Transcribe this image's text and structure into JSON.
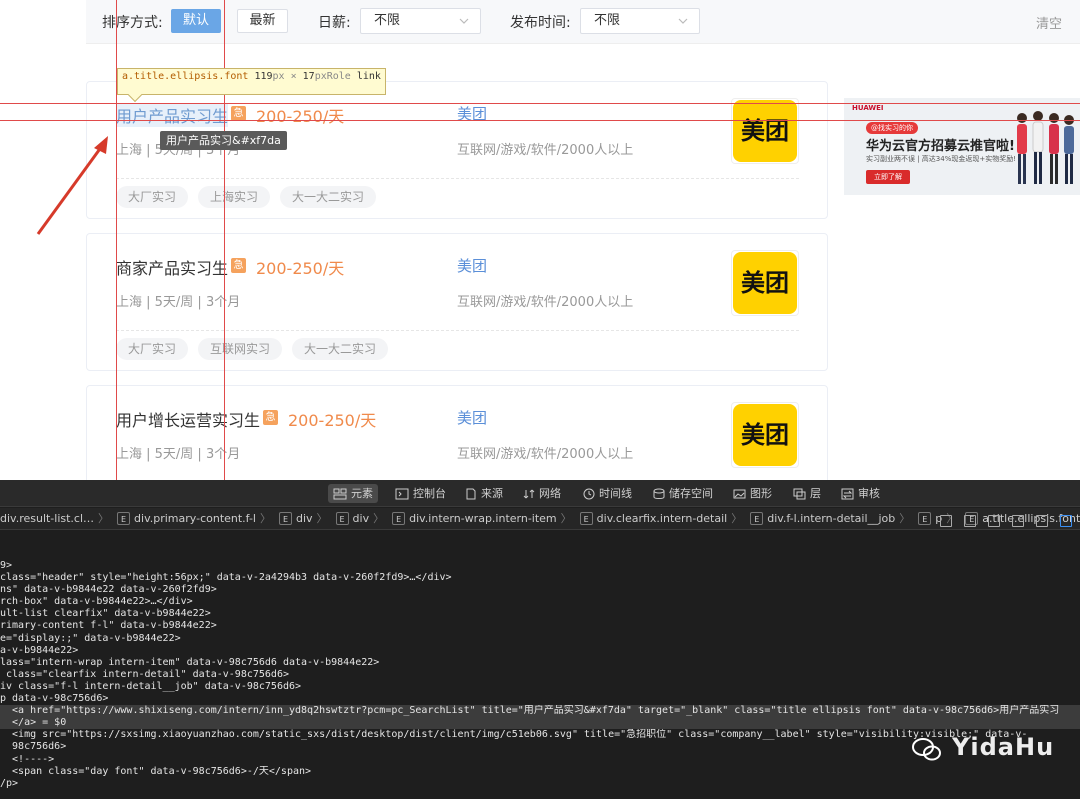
{
  "filter": {
    "sort_label": "排序方式:",
    "sort_default": "默认",
    "sort_latest": "最新",
    "salary_label": "日薪:",
    "salary_value": "不限",
    "time_label": "发布时间:",
    "time_value": "不限",
    "clear": "清空"
  },
  "inspector": {
    "selector": "a.title.ellipsis.font",
    "width": "119",
    "unit1": "px",
    "times": " × ",
    "height": "17",
    "unit2": "px",
    "role_label": "Role",
    "role_value": " link",
    "title_tooltip": "用户产品实习&#xf7da"
  },
  "jobs": [
    {
      "title": "用户产品实习生",
      "urgent": "急",
      "salary": "200-250/天",
      "meta": "上海 | 5天/周 | 3个月",
      "company": "美团",
      "industry": "互联网/游戏/软件/2000人以上",
      "logo_text": "美团",
      "tags": [
        "大厂实习",
        "上海实习",
        "大一大二实习"
      ]
    },
    {
      "title": "商家产品实习生",
      "urgent": "急",
      "salary": "200-250/天",
      "meta": "上海 | 5天/周 | 3个月",
      "company": "美团",
      "industry": "互联网/游戏/软件/2000人以上",
      "logo_text": "美团",
      "tags": [
        "大厂实习",
        "互联网实习",
        "大一大二实习"
      ]
    },
    {
      "title": "用户增长运营实习生",
      "urgent": "急",
      "salary": "200-250/天",
      "meta": "上海 | 5天/周 | 3个月",
      "company": "美团",
      "industry": "互联网/游戏/软件/2000人以上",
      "logo_text": "美团",
      "tags": []
    }
  ],
  "ad": {
    "brand": "HUAWEI",
    "badge": "@找实习的你",
    "title": "华为云官方招募云推官啦!",
    "subtitle": "实习副业两不误 | 高达34%现金返现+实物奖励!",
    "cta": "立即了解"
  },
  "devtools": {
    "tabs": [
      "元素",
      "控制台",
      "来源",
      "网络",
      "时间线",
      "储存空间",
      "图形",
      "层",
      "审核"
    ],
    "breadcrumbs": [
      "div.result-list.cl…",
      "div.primary-content.f-l",
      "div",
      "div",
      "div.intern-wrap.intern-item",
      "div.clearfix.intern-detail",
      "div.f-l.intern-detail__job",
      "p",
      "a.title.ellipsis.font"
    ],
    "code_lines": [
      "9>",
      "class=\"header\" style=\"height:56px;\" data-v-2a4294b3 data-v-260f2fd9>…</div>",
      "ns\" data-v-b9844e22 data-v-260f2fd9>",
      "rch-box\" data-v-b9844e22>…</div>",
      "ult-list clearfix\" data-v-b9844e22>",
      "rimary-content f-l\" data-v-b9844e22>",
      "e=\"display:;\" data-v-b9844e22>",
      "a-v-b9844e22>",
      "lass=\"intern-wrap intern-item\" data-v-98c756d6 data-v-b9844e22>",
      " class=\"clearfix intern-detail\" data-v-98c756d6>",
      "iv class=\"f-l intern-detail__job\" data-v-98c756d6>",
      "p data-v-98c756d6>",
      "  <a href=\"https://www.shixiseng.com/intern/inn_yd8q2hswtztr?pcm=pc_SearchList\" title=\"用户产品实习&#xf7da\" target=\"_blank\" class=\"title ellipsis font\" data-v-98c756d6>用户产品实习",
      "  </a> = $0",
      "  <img src=\"https://sxsimg.xiaoyuanzhao.com/static_sxs/dist/desktop/dist/client/img/c51eb06.svg\" title=\"急招职位\" class=\"company__label\" style=\"visibility:visible;\" data-v-",
      "  98c756d6>",
      "  <!---->",
      "  <span class=\"day font\" data-v-98c756d6>-/天</span>",
      "/p>"
    ]
  },
  "watermark": "YidaHu"
}
